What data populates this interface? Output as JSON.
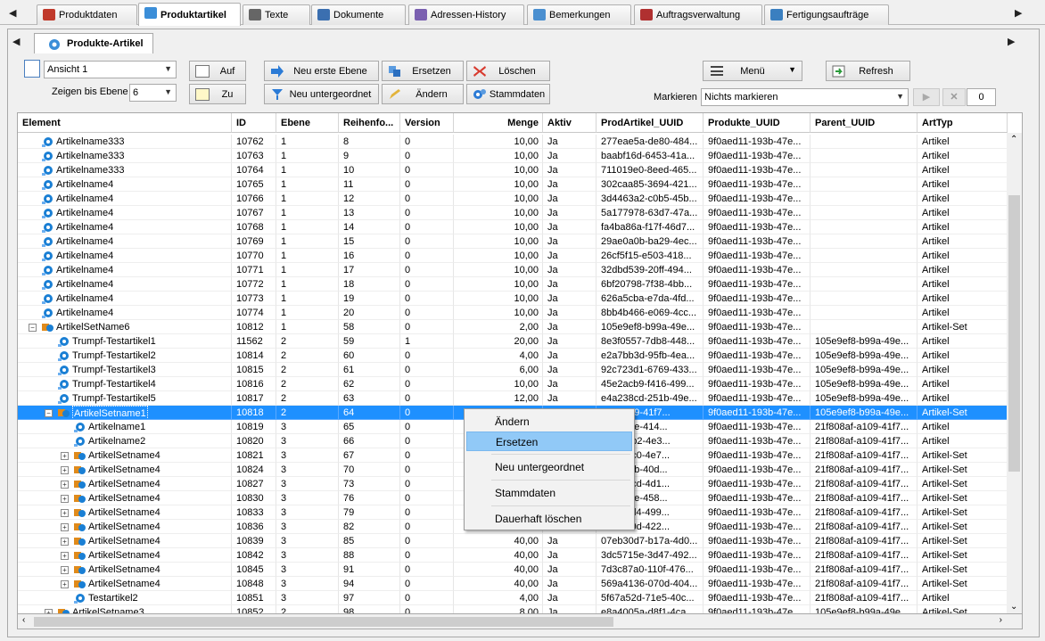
{
  "top_tabs": [
    {
      "label": "Produktdaten",
      "icon": "product-data-icon",
      "active": false
    },
    {
      "label": "Produktartikel",
      "icon": "product-article-icon",
      "active": true
    },
    {
      "label": "Texte",
      "icon": "text-icon",
      "active": false
    },
    {
      "label": "Dokumente",
      "icon": "document-icon",
      "active": false
    },
    {
      "label": "Adressen-History",
      "icon": "address-history-icon",
      "active": false
    },
    {
      "label": "Bemerkungen",
      "icon": "comments-icon",
      "active": false
    },
    {
      "label": "Auftragsverwaltung",
      "icon": "order-book-icon",
      "active": false
    },
    {
      "label": "Fertigungsaufträge",
      "icon": "production-order-icon",
      "active": false
    }
  ],
  "inner_tab": {
    "label": "Produkte-Artikel"
  },
  "toolbar": {
    "view_select": "Ansicht 1",
    "show_level_label": "Zeigen bis Ebene",
    "level_value": "6",
    "up_label": "Auf",
    "to_label": "Zu",
    "new_first_level": "Neu erste Ebene",
    "new_child": "Neu untergeordnet",
    "replace": "Ersetzen",
    "change": "Ändern",
    "delete": "Löschen",
    "master_data": "Stammdaten",
    "menu": "Menü",
    "refresh": "Refresh",
    "mark_label": "Markieren",
    "mark_select": "Nichts markieren",
    "mark_count": "0"
  },
  "columns": [
    "Element",
    "ID",
    "Ebene",
    "Reihenfo...",
    "Version",
    "Menge",
    "Aktiv",
    "ProdArtikel_UUID",
    "Produkte_UUID",
    "Parent_UUID",
    "ArtTyp"
  ],
  "rows": [
    {
      "name": "Artikelname333",
      "id": "10762",
      "ebene": "1",
      "reihe": "8",
      "version": "0",
      "menge": "10,00",
      "aktiv": "Ja",
      "prod_uuid": "277eae5a-de80-484...",
      "produkte_uuid": "9f0aed11-193b-47e...",
      "parent_uuid": "",
      "arttyp": "Artikel",
      "indent": 0,
      "kind": "item",
      "exp": ""
    },
    {
      "name": "Artikelname333",
      "id": "10763",
      "ebene": "1",
      "reihe": "9",
      "version": "0",
      "menge": "10,00",
      "aktiv": "Ja",
      "prod_uuid": "baabf16d-6453-41a...",
      "produkte_uuid": "9f0aed11-193b-47e...",
      "parent_uuid": "",
      "arttyp": "Artikel",
      "indent": 0,
      "kind": "item",
      "exp": ""
    },
    {
      "name": "Artikelname333",
      "id": "10764",
      "ebene": "1",
      "reihe": "10",
      "version": "0",
      "menge": "10,00",
      "aktiv": "Ja",
      "prod_uuid": "711019e0-8eed-465...",
      "produkte_uuid": "9f0aed11-193b-47e...",
      "parent_uuid": "",
      "arttyp": "Artikel",
      "indent": 0,
      "kind": "item",
      "exp": ""
    },
    {
      "name": "Artikelname4",
      "id": "10765",
      "ebene": "1",
      "reihe": "11",
      "version": "0",
      "menge": "10,00",
      "aktiv": "Ja",
      "prod_uuid": "302caa85-3694-421...",
      "produkte_uuid": "9f0aed11-193b-47e...",
      "parent_uuid": "",
      "arttyp": "Artikel",
      "indent": 0,
      "kind": "item",
      "exp": ""
    },
    {
      "name": "Artikelname4",
      "id": "10766",
      "ebene": "1",
      "reihe": "12",
      "version": "0",
      "menge": "10,00",
      "aktiv": "Ja",
      "prod_uuid": "3d4463a2-c0b5-45b...",
      "produkte_uuid": "9f0aed11-193b-47e...",
      "parent_uuid": "",
      "arttyp": "Artikel",
      "indent": 0,
      "kind": "item",
      "exp": ""
    },
    {
      "name": "Artikelname4",
      "id": "10767",
      "ebene": "1",
      "reihe": "13",
      "version": "0",
      "menge": "10,00",
      "aktiv": "Ja",
      "prod_uuid": "5a177978-63d7-47a...",
      "produkte_uuid": "9f0aed11-193b-47e...",
      "parent_uuid": "",
      "arttyp": "Artikel",
      "indent": 0,
      "kind": "item",
      "exp": ""
    },
    {
      "name": "Artikelname4",
      "id": "10768",
      "ebene": "1",
      "reihe": "14",
      "version": "0",
      "menge": "10,00",
      "aktiv": "Ja",
      "prod_uuid": "fa4ba86a-f17f-46d7...",
      "produkte_uuid": "9f0aed11-193b-47e...",
      "parent_uuid": "",
      "arttyp": "Artikel",
      "indent": 0,
      "kind": "item",
      "exp": ""
    },
    {
      "name": "Artikelname4",
      "id": "10769",
      "ebene": "1",
      "reihe": "15",
      "version": "0",
      "menge": "10,00",
      "aktiv": "Ja",
      "prod_uuid": "29ae0a0b-ba29-4ec...",
      "produkte_uuid": "9f0aed11-193b-47e...",
      "parent_uuid": "",
      "arttyp": "Artikel",
      "indent": 0,
      "kind": "item",
      "exp": ""
    },
    {
      "name": "Artikelname4",
      "id": "10770",
      "ebene": "1",
      "reihe": "16",
      "version": "0",
      "menge": "10,00",
      "aktiv": "Ja",
      "prod_uuid": "26cf5f15-e503-418...",
      "produkte_uuid": "9f0aed11-193b-47e...",
      "parent_uuid": "",
      "arttyp": "Artikel",
      "indent": 0,
      "kind": "item",
      "exp": ""
    },
    {
      "name": "Artikelname4",
      "id": "10771",
      "ebene": "1",
      "reihe": "17",
      "version": "0",
      "menge": "10,00",
      "aktiv": "Ja",
      "prod_uuid": "32dbd539-20ff-494...",
      "produkte_uuid": "9f0aed11-193b-47e...",
      "parent_uuid": "",
      "arttyp": "Artikel",
      "indent": 0,
      "kind": "item",
      "exp": ""
    },
    {
      "name": "Artikelname4",
      "id": "10772",
      "ebene": "1",
      "reihe": "18",
      "version": "0",
      "menge": "10,00",
      "aktiv": "Ja",
      "prod_uuid": "6bf20798-7f38-4bb...",
      "produkte_uuid": "9f0aed11-193b-47e...",
      "parent_uuid": "",
      "arttyp": "Artikel",
      "indent": 0,
      "kind": "item",
      "exp": ""
    },
    {
      "name": "Artikelname4",
      "id": "10773",
      "ebene": "1",
      "reihe": "19",
      "version": "0",
      "menge": "10,00",
      "aktiv": "Ja",
      "prod_uuid": "626a5cba-e7da-4fd...",
      "produkte_uuid": "9f0aed11-193b-47e...",
      "parent_uuid": "",
      "arttyp": "Artikel",
      "indent": 0,
      "kind": "item",
      "exp": ""
    },
    {
      "name": "Artikelname4",
      "id": "10774",
      "ebene": "1",
      "reihe": "20",
      "version": "0",
      "menge": "10,00",
      "aktiv": "Ja",
      "prod_uuid": "8bb4b466-e069-4cc...",
      "produkte_uuid": "9f0aed11-193b-47e...",
      "parent_uuid": "",
      "arttyp": "Artikel",
      "indent": 0,
      "kind": "item",
      "exp": ""
    },
    {
      "name": "ArtikelSetName6",
      "id": "10812",
      "ebene": "1",
      "reihe": "58",
      "version": "0",
      "menge": "2,00",
      "aktiv": "Ja",
      "prod_uuid": "105e9ef8-b99a-49e...",
      "produkte_uuid": "9f0aed11-193b-47e...",
      "parent_uuid": "",
      "arttyp": "Artikel-Set",
      "indent": 0,
      "kind": "set",
      "exp": "−"
    },
    {
      "name": "Trumpf-Testartikel1",
      "id": "11562",
      "ebene": "2",
      "reihe": "59",
      "version": "1",
      "menge": "20,00",
      "aktiv": "Ja",
      "prod_uuid": "8e3f0557-7db8-448...",
      "produkte_uuid": "9f0aed11-193b-47e...",
      "parent_uuid": "105e9ef8-b99a-49e...",
      "arttyp": "Artikel",
      "indent": 1,
      "kind": "item",
      "exp": ""
    },
    {
      "name": "Trumpf-Testartikel2",
      "id": "10814",
      "ebene": "2",
      "reihe": "60",
      "version": "0",
      "menge": "4,00",
      "aktiv": "Ja",
      "prod_uuid": "e2a7bb3d-95fb-4ea...",
      "produkte_uuid": "9f0aed11-193b-47e...",
      "parent_uuid": "105e9ef8-b99a-49e...",
      "arttyp": "Artikel",
      "indent": 1,
      "kind": "item",
      "exp": ""
    },
    {
      "name": "Trumpf-Testartikel3",
      "id": "10815",
      "ebene": "2",
      "reihe": "61",
      "version": "0",
      "menge": "6,00",
      "aktiv": "Ja",
      "prod_uuid": "92c723d1-6769-433...",
      "produkte_uuid": "9f0aed11-193b-47e...",
      "parent_uuid": "105e9ef8-b99a-49e...",
      "arttyp": "Artikel",
      "indent": 1,
      "kind": "item",
      "exp": ""
    },
    {
      "name": "Trumpf-Testartikel4",
      "id": "10816",
      "ebene": "2",
      "reihe": "62",
      "version": "0",
      "menge": "10,00",
      "aktiv": "Ja",
      "prod_uuid": "45e2acb9-f416-499...",
      "produkte_uuid": "9f0aed11-193b-47e...",
      "parent_uuid": "105e9ef8-b99a-49e...",
      "arttyp": "Artikel",
      "indent": 1,
      "kind": "item",
      "exp": ""
    },
    {
      "name": "Trumpf-Testartikel5",
      "id": "10817",
      "ebene": "2",
      "reihe": "63",
      "version": "0",
      "menge": "12,00",
      "aktiv": "Ja",
      "prod_uuid": "e4a238cd-251b-49e...",
      "produkte_uuid": "9f0aed11-193b-47e...",
      "parent_uuid": "105e9ef8-b99a-49e...",
      "arttyp": "Artikel",
      "indent": 1,
      "kind": "item",
      "exp": ""
    },
    {
      "name": "ArtikelSetname1",
      "id": "10818",
      "ebene": "2",
      "reihe": "64",
      "version": "0",
      "menge": "",
      "aktiv": "",
      "prod_uuid": "8af-a109-41f7...",
      "produkte_uuid": "9f0aed11-193b-47e...",
      "parent_uuid": "105e9ef8-b99a-49e...",
      "arttyp": "Artikel-Set",
      "indent": 1,
      "kind": "set",
      "exp": "−",
      "selected": true
    },
    {
      "name": "Artikelname1",
      "id": "10819",
      "ebene": "3",
      "reihe": "65",
      "version": "0",
      "menge": "",
      "aktiv": "",
      "prod_uuid": "951-37fe-414...",
      "produkte_uuid": "9f0aed11-193b-47e...",
      "parent_uuid": "21f808af-a109-41f7...",
      "arttyp": "Artikel",
      "indent": 2,
      "kind": "item",
      "exp": ""
    },
    {
      "name": "Artikelname2",
      "id": "10820",
      "ebene": "3",
      "reihe": "66",
      "version": "0",
      "menge": "",
      "aktiv": "",
      "prod_uuid": "931-41b2-4e3...",
      "produkte_uuid": "9f0aed11-193b-47e...",
      "parent_uuid": "21f808af-a109-41f7...",
      "arttyp": "Artikel",
      "indent": 2,
      "kind": "item",
      "exp": ""
    },
    {
      "name": "ArtikelSetname4",
      "id": "10821",
      "ebene": "3",
      "reihe": "67",
      "version": "0",
      "menge": "",
      "aktiv": "",
      "prod_uuid": "1bb-ddc0-4e7...",
      "produkte_uuid": "9f0aed11-193b-47e...",
      "parent_uuid": "21f808af-a109-41f7...",
      "arttyp": "Artikel-Set",
      "indent": 2,
      "kind": "set",
      "exp": "+"
    },
    {
      "name": "ArtikelSetname4",
      "id": "10824",
      "ebene": "3",
      "reihe": "70",
      "version": "0",
      "menge": "",
      "aktiv": "",
      "prod_uuid": "efd-96ab-40d...",
      "produkte_uuid": "9f0aed11-193b-47e...",
      "parent_uuid": "21f808af-a109-41f7...",
      "arttyp": "Artikel-Set",
      "indent": 2,
      "kind": "set",
      "exp": "+"
    },
    {
      "name": "ArtikelSetname4",
      "id": "10827",
      "ebene": "3",
      "reihe": "73",
      "version": "0",
      "menge": "",
      "aktiv": "",
      "prod_uuid": "179-e3cd-4d1...",
      "produkte_uuid": "9f0aed11-193b-47e...",
      "parent_uuid": "21f808af-a109-41f7...",
      "arttyp": "Artikel-Set",
      "indent": 2,
      "kind": "set",
      "exp": "+"
    },
    {
      "name": "ArtikelSetname4",
      "id": "10830",
      "ebene": "3",
      "reihe": "76",
      "version": "0",
      "menge": "",
      "aktiv": "",
      "prod_uuid": "137-85fe-458...",
      "produkte_uuid": "9f0aed11-193b-47e...",
      "parent_uuid": "21f808af-a109-41f7...",
      "arttyp": "Artikel-Set",
      "indent": 2,
      "kind": "set",
      "exp": "+"
    },
    {
      "name": "ArtikelSetname4",
      "id": "10833",
      "ebene": "3",
      "reihe": "79",
      "version": "0",
      "menge": "",
      "aktiv": "",
      "prod_uuid": "112-1ed4-499...",
      "produkte_uuid": "9f0aed11-193b-47e...",
      "parent_uuid": "21f808af-a109-41f7...",
      "arttyp": "Artikel-Set",
      "indent": 2,
      "kind": "set",
      "exp": "+"
    },
    {
      "name": "ArtikelSetname4",
      "id": "10836",
      "ebene": "3",
      "reihe": "82",
      "version": "0",
      "menge": "",
      "aktiv": "",
      "prod_uuid": "e23-c59d-422...",
      "produkte_uuid": "9f0aed11-193b-47e...",
      "parent_uuid": "21f808af-a109-41f7...",
      "arttyp": "Artikel-Set",
      "indent": 2,
      "kind": "set",
      "exp": "+"
    },
    {
      "name": "ArtikelSetname4",
      "id": "10839",
      "ebene": "3",
      "reihe": "85",
      "version": "0",
      "menge": "40,00",
      "aktiv": "Ja",
      "prod_uuid": "07eb30d7-b17a-4d0...",
      "produkte_uuid": "9f0aed11-193b-47e...",
      "parent_uuid": "21f808af-a109-41f7...",
      "arttyp": "Artikel-Set",
      "indent": 2,
      "kind": "set",
      "exp": "+"
    },
    {
      "name": "ArtikelSetname4",
      "id": "10842",
      "ebene": "3",
      "reihe": "88",
      "version": "0",
      "menge": "40,00",
      "aktiv": "Ja",
      "prod_uuid": "3dc5715e-3d47-492...",
      "produkte_uuid": "9f0aed11-193b-47e...",
      "parent_uuid": "21f808af-a109-41f7...",
      "arttyp": "Artikel-Set",
      "indent": 2,
      "kind": "set",
      "exp": "+"
    },
    {
      "name": "ArtikelSetname4",
      "id": "10845",
      "ebene": "3",
      "reihe": "91",
      "version": "0",
      "menge": "40,00",
      "aktiv": "Ja",
      "prod_uuid": "7d3c87a0-110f-476...",
      "produkte_uuid": "9f0aed11-193b-47e...",
      "parent_uuid": "21f808af-a109-41f7...",
      "arttyp": "Artikel-Set",
      "indent": 2,
      "kind": "set",
      "exp": "+"
    },
    {
      "name": "ArtikelSetname4",
      "id": "10848",
      "ebene": "3",
      "reihe": "94",
      "version": "0",
      "menge": "40,00",
      "aktiv": "Ja",
      "prod_uuid": "569a4136-070d-404...",
      "produkte_uuid": "9f0aed11-193b-47e...",
      "parent_uuid": "21f808af-a109-41f7...",
      "arttyp": "Artikel-Set",
      "indent": 2,
      "kind": "set",
      "exp": "+"
    },
    {
      "name": "Testartikel2",
      "id": "10851",
      "ebene": "3",
      "reihe": "97",
      "version": "0",
      "menge": "4,00",
      "aktiv": "Ja",
      "prod_uuid": "5f67a52d-71e5-40c...",
      "produkte_uuid": "9f0aed11-193b-47e...",
      "parent_uuid": "21f808af-a109-41f7...",
      "arttyp": "Artikel",
      "indent": 2,
      "kind": "item",
      "exp": ""
    },
    {
      "name": "ArtikelSetname3",
      "id": "10852",
      "ebene": "2",
      "reihe": "98",
      "version": "0",
      "menge": "8,00",
      "aktiv": "Ja",
      "prod_uuid": "e8a4005a-d8f1-4ca...",
      "produkte_uuid": "9f0aed11-193b-47e...",
      "parent_uuid": "105e9ef8-b99a-49e...",
      "arttyp": "Artikel-Set",
      "indent": 1,
      "kind": "set",
      "exp": "+"
    }
  ],
  "context_menu": [
    {
      "label": "Ändern",
      "highlight": false
    },
    {
      "label": "Ersetzen",
      "highlight": true
    },
    {
      "label": "Neu untergeordnet",
      "highlight": false
    },
    {
      "label": "Stammdaten",
      "highlight": false
    },
    {
      "label": "Dauerhaft löschen",
      "highlight": false
    }
  ],
  "colors": {
    "selection": "#1e90ff",
    "menu_highlight": "#91c9f7",
    "item_icon": "#1a7fd4",
    "set_icon": "#e08a1a"
  }
}
